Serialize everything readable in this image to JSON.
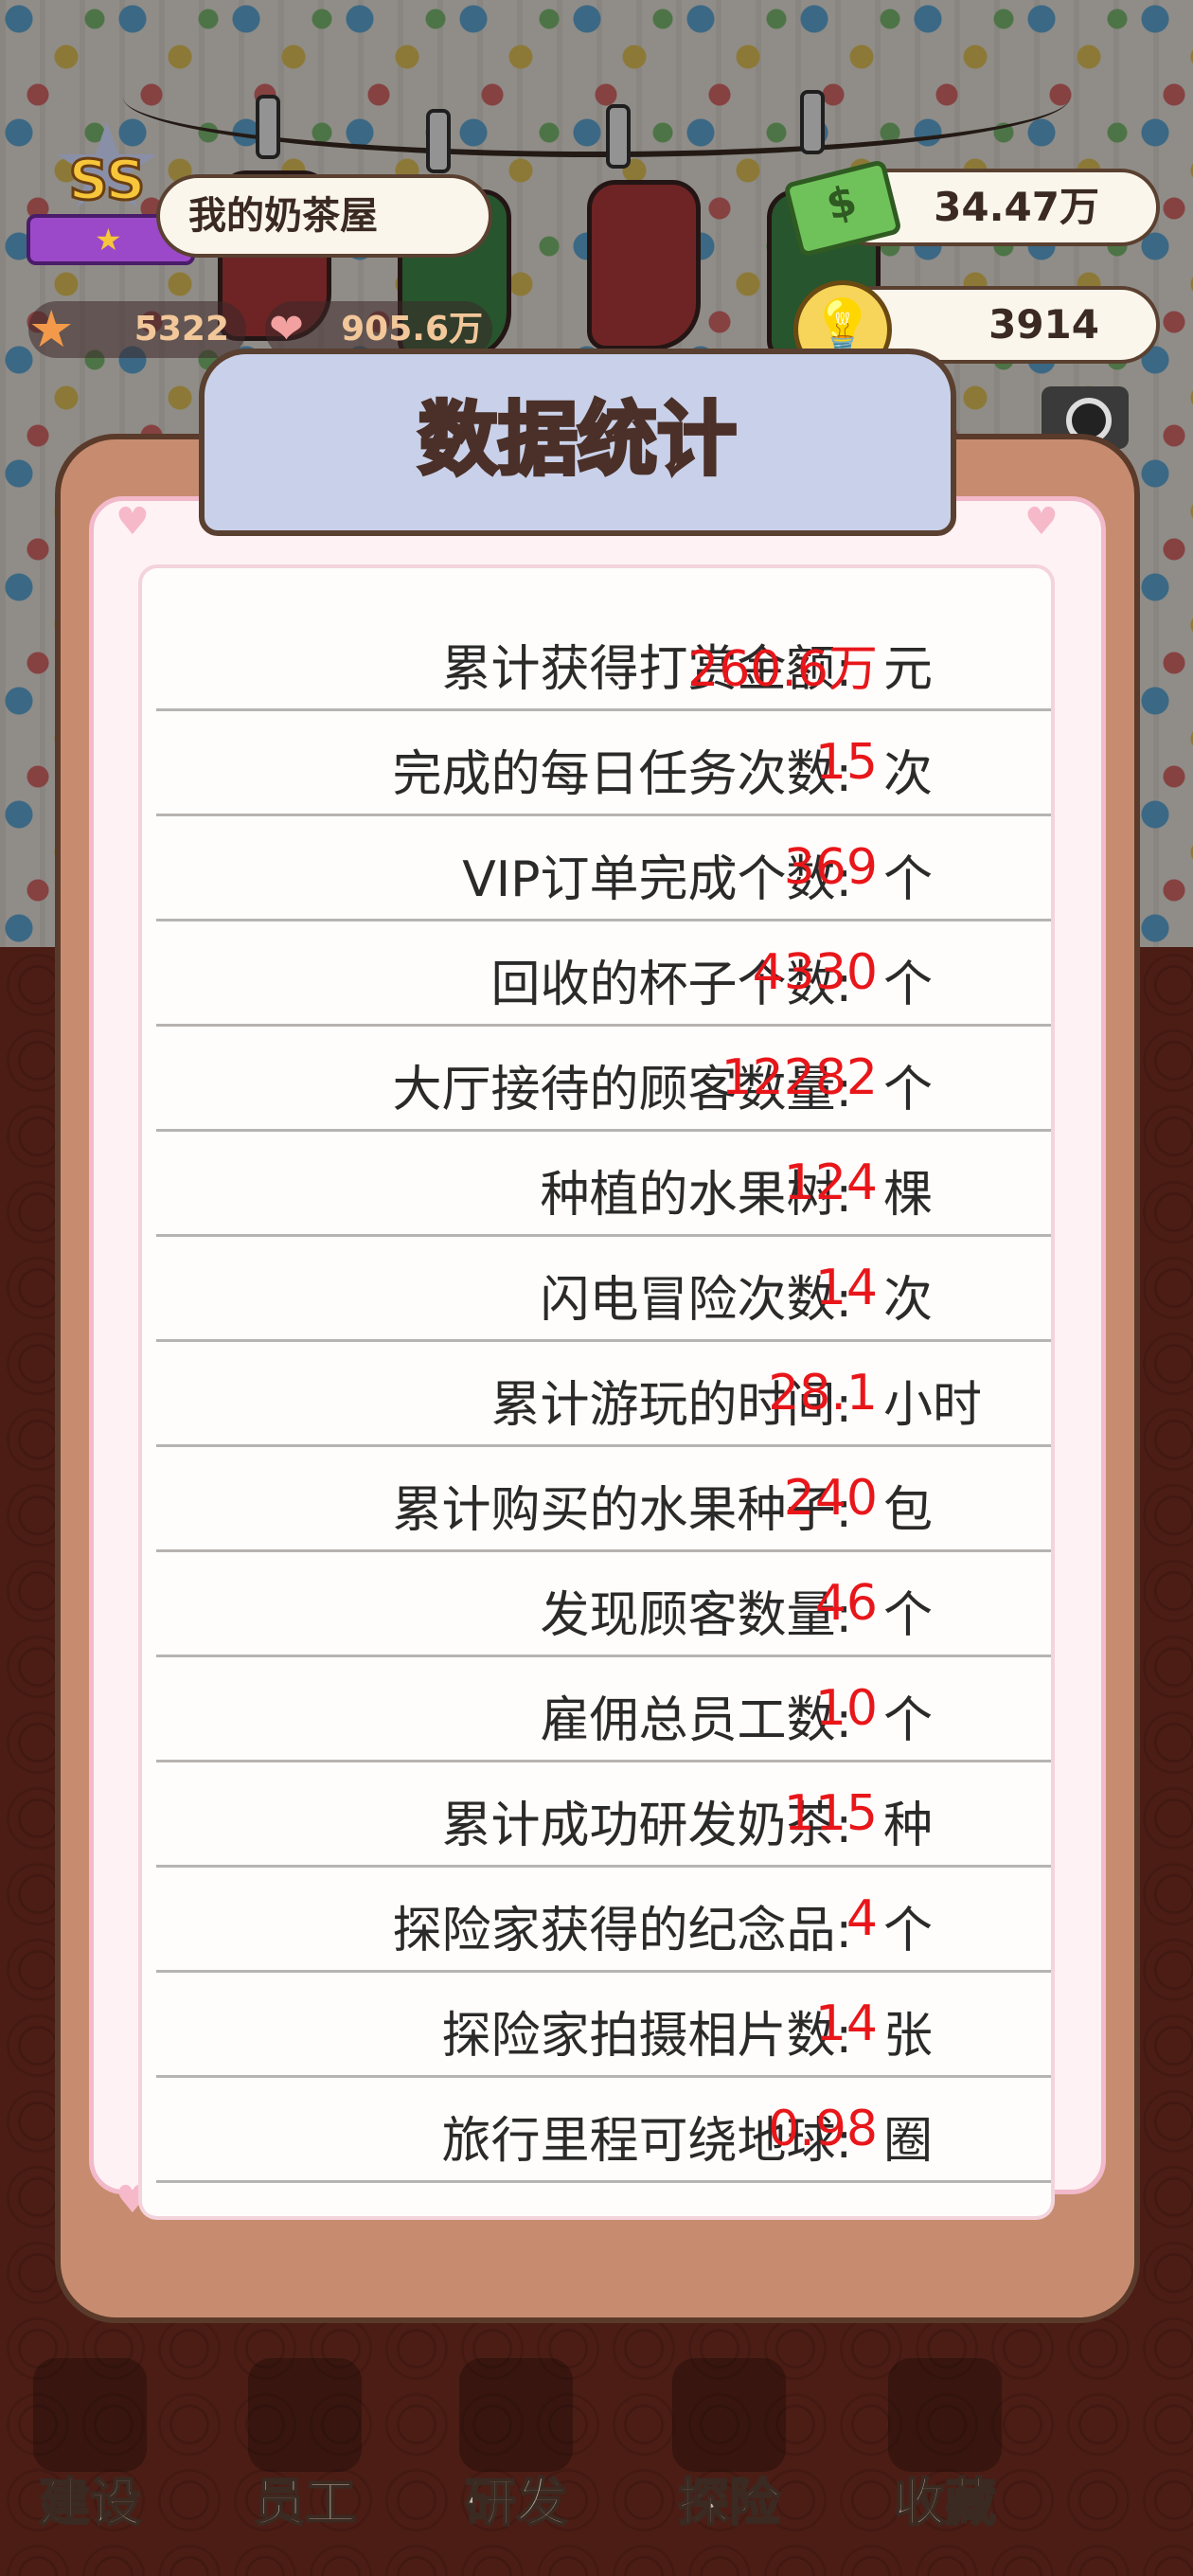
{
  "hud": {
    "rank_badge": "SS",
    "shop_name": "我的奶茶屋",
    "stars": "5322",
    "fans": "905.6万",
    "money": "34.47万",
    "ideas": "3914"
  },
  "modal": {
    "title": "数据统计",
    "stats": [
      {
        "label": "累计获得打赏金额",
        "value": "260.6万",
        "unit": "元"
      },
      {
        "label": "完成的每日任务次数",
        "value": "15",
        "unit": "次"
      },
      {
        "label": "VIP订单完成个数",
        "value": "369",
        "unit": "个"
      },
      {
        "label": "回收的杯子个数",
        "value": "4330",
        "unit": "个"
      },
      {
        "label": "大厅接待的顾客数量",
        "value": "12282",
        "unit": "个"
      },
      {
        "label": "种植的水果树",
        "value": "124",
        "unit": "棵"
      },
      {
        "label": "闪电冒险次数",
        "value": "14",
        "unit": "次"
      },
      {
        "label": "累计游玩的时间",
        "value": "28.1",
        "unit": "小时"
      },
      {
        "label": "累计购买的水果种子",
        "value": "240",
        "unit": "包"
      },
      {
        "label": "发现顾客数量",
        "value": "46",
        "unit": "个"
      },
      {
        "label": "雇佣总员工数",
        "value": "10",
        "unit": "个"
      },
      {
        "label": "累计成功研发奶茶",
        "value": "115",
        "unit": "种"
      },
      {
        "label": "探险家获得的纪念品",
        "value": "4",
        "unit": "个"
      },
      {
        "label": "探险家拍摄相片数",
        "value": "14",
        "unit": "张"
      },
      {
        "label": "旅行里程可绕地球",
        "value": "0.98",
        "unit": "圈"
      }
    ]
  },
  "nav": [
    {
      "label": "建设",
      "icon": "hammer-icon"
    },
    {
      "label": "员工",
      "icon": "staff-icon"
    },
    {
      "label": "研发",
      "icon": "cup-icon"
    },
    {
      "label": "探险",
      "icon": "compass-icon"
    },
    {
      "label": "收藏",
      "icon": "collection-icon"
    }
  ],
  "colors": {
    "value_red": "#e8161a",
    "title_tab": "#c9d1ea",
    "modal_frame": "#c78c6f"
  }
}
